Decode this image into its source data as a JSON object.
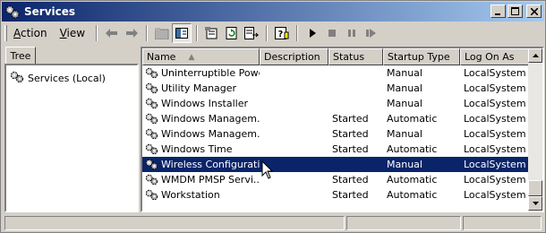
{
  "window": {
    "title": "Services"
  },
  "titlebar_buttons": {
    "minimize": "_",
    "maximize": "□",
    "close": "×"
  },
  "menu": {
    "action": {
      "underline": "A",
      "rest": "ction"
    },
    "view": {
      "underline": "V",
      "rest": "iew"
    }
  },
  "toolbar_icons": [
    "back-arrow-icon",
    "forward-arrow-icon",
    "up-folder-icon",
    "show-hide-tree-icon",
    "properties-icon",
    "refresh-icon",
    "export-list-icon",
    "help-icon",
    "play-icon",
    "stop-icon",
    "pause-icon",
    "restart-icon"
  ],
  "tree": {
    "tab_label": "Tree",
    "root_label": "Services (Local)"
  },
  "list": {
    "columns": [
      "Name",
      "Description",
      "Status",
      "Startup Type",
      "Log On As"
    ],
    "sort_indicator": "▲",
    "rows": [
      {
        "name": "Uninterruptible Powe...",
        "description": "",
        "status": "",
        "startup": "Manual",
        "logon": "LocalSystem"
      },
      {
        "name": "Utility Manager",
        "description": "",
        "status": "",
        "startup": "Manual",
        "logon": "LocalSystem"
      },
      {
        "name": "Windows Installer",
        "description": "",
        "status": "",
        "startup": "Manual",
        "logon": "LocalSystem"
      },
      {
        "name": "Windows Managem...",
        "description": "",
        "status": "Started",
        "startup": "Automatic",
        "logon": "LocalSystem"
      },
      {
        "name": "Windows Managem...",
        "description": "",
        "status": "Started",
        "startup": "Manual",
        "logon": "LocalSystem"
      },
      {
        "name": "Windows Time",
        "description": "",
        "status": "Started",
        "startup": "Automatic",
        "logon": "LocalSystem"
      },
      {
        "name": "Wireless Configuration",
        "description": "",
        "status": "",
        "startup": "Manual",
        "logon": "LocalSystem",
        "selected": true
      },
      {
        "name": "WMDM PMSP Servi...",
        "description": "",
        "status": "Started",
        "startup": "Automatic",
        "logon": "LocalSystem"
      },
      {
        "name": "Workstation",
        "description": "",
        "status": "Started",
        "startup": "Automatic",
        "logon": "LocalSystem"
      }
    ]
  },
  "colors": {
    "titlebar_start": "#0a246a",
    "titlebar_end": "#a6caf0",
    "selection": "#0a246a",
    "face": "#d4d0c8"
  }
}
